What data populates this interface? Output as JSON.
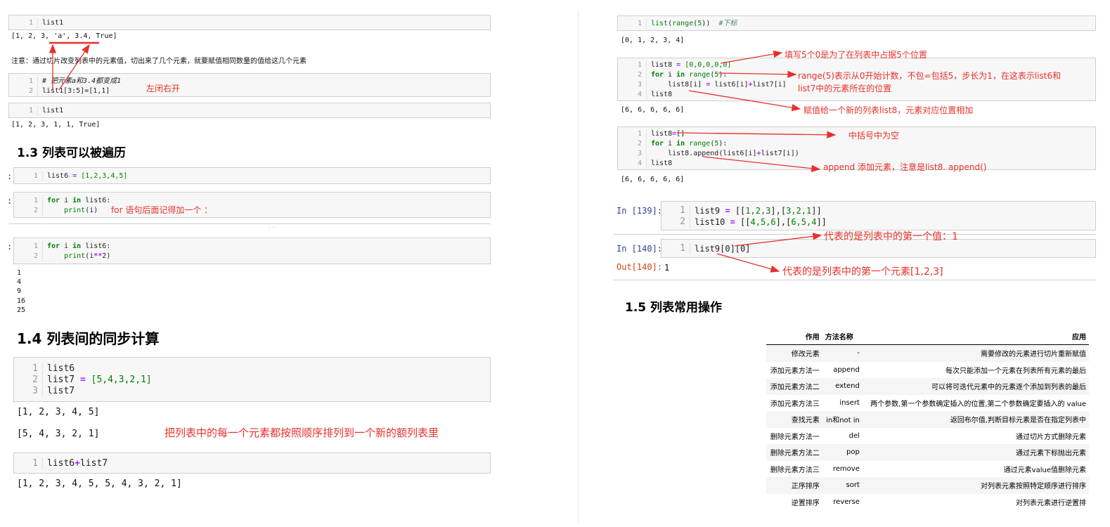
{
  "left": {
    "cell1": {
      "lines": [
        "list1"
      ],
      "line_numbers": [
        "1"
      ]
    },
    "out1": "[1, 2, 3, 'a', 3.4, True]",
    "note_text": "注意：通过切片改变列表中的元素值，切出来了几个元素，就要赋值相同数量的值给这几个元素",
    "cell2": {
      "comment": "# 把元素a和3.4都变成1",
      "code": "list1[3:5]=[1,1]",
      "line_numbers": [
        "1",
        "2"
      ]
    },
    "ann_left_closed": "左闭右开",
    "cell3": {
      "lines": [
        "list1"
      ],
      "line_numbers": [
        "1"
      ]
    },
    "out3": "[1, 2, 3, 1, 1, True]",
    "h_1_3": "1.3  列表可以被遍历",
    "cell4": {
      "code": "list6 = [1,2,3,4,5]",
      "line_numbers": [
        "1"
      ]
    },
    "cell5": {
      "line1": "for i in list6:",
      "line2": "    print(i)",
      "line_numbers": [
        "1",
        "2"
      ]
    },
    "ann_for": "for 语句后面记得加一个  ：",
    "ellipsis": "· · ·",
    "cell6": {
      "line1": "for i in list6:",
      "line2": "    print(i**2)",
      "line_numbers": [
        "1",
        "2"
      ]
    },
    "out6": [
      "1",
      "4",
      "9",
      "16",
      "25"
    ],
    "h_1_4": "1.4  列表间的同步计算",
    "cell7": {
      "line1": "list6",
      "line2": "list7 = [5,4,3,2,1]",
      "line3": "list7",
      "line_numbers": [
        "1",
        "2",
        "3"
      ]
    },
    "out7a": "[1, 2, 3, 4, 5]",
    "out7b": "[5, 4, 3, 2, 1]",
    "ann_sync": "把列表中的每一个元素都按照顺序排列到一个新的额列表里",
    "cell8": {
      "code": "list6+list7",
      "line_numbers": [
        "1"
      ]
    },
    "out8": "[1, 2, 3, 4, 5, 5, 4, 3, 2, 1]",
    "colon_prompts": [
      ":",
      ":",
      ":"
    ]
  },
  "right": {
    "cell1": {
      "code": "list(range(5))",
      "comment": "#下标",
      "line_numbers": [
        "1"
      ]
    },
    "out1": "[0, 1, 2, 3, 4]",
    "cell2": {
      "line1": "list8 = [0,0,0,0,0]",
      "line2": "for i in range(5):",
      "line3": "    list8[i] = list6[i]+list7[i]",
      "line4": "list8",
      "line_numbers": [
        "1",
        "2",
        "3",
        "4"
      ]
    },
    "ann_zeros": "填写5个0是为了在列表中占据5个位置",
    "ann_range_1": "range(5)表示从0开始计数，不包=包括5，步长为1，在这表示list6和",
    "ann_range_2": "list7中的元素所在的位置",
    "ann_assign": "赋值给一个新的列表list8，元素对应位置相加",
    "out2": "[6, 6, 6, 6, 6]",
    "cell3": {
      "line1": "list8=[]",
      "line2": "for i in range(5):",
      "line3": "    list8.append(list6[i]+list7[i])",
      "line4": "list8",
      "line_numbers": [
        "1",
        "2",
        "3",
        "4"
      ]
    },
    "ann_empty": "中括号中为空",
    "ann_append": "append 添加元素，注意是list8. append()",
    "out3": "[6, 6, 6, 6, 6]",
    "prompt_139": "In [139]:",
    "cell4": {
      "line1": "list9 = [[1,2,3],[3,2,1]]",
      "line2": "list10 = [[4,5,6],[6,5,4]]",
      "line_numbers": [
        "1",
        "2"
      ]
    },
    "prompt_140": "In [140]:",
    "cell5": {
      "code": "list9[0][0]",
      "line_numbers": [
        "1"
      ]
    },
    "prompt_out_140": "Out[140]:",
    "out5": "1",
    "ann_first_value": "代表的是列表中的第一个值：1",
    "ann_first_element": "代表的是列表中的第一个元素[1,2,3]",
    "h_1_5": "1.5  列表常用操作",
    "table": {
      "headers": [
        "作用",
        "方法名称",
        "应用"
      ],
      "rows": [
        [
          "修改元素",
          "-",
          "需要修改的元素进行切片重新赋值"
        ],
        [
          "添加元素方法一",
          "append",
          "每次只能添加一个元素在列表所有元素的最后"
        ],
        [
          "添加元素方法二",
          "extend",
          "可以将可迭代元素中的元素逐个添加到列表的最后"
        ],
        [
          "添加元素方法三",
          "insert",
          "两个参数,第一个参数确定插入的位置,第二个参数确定要插入的 value"
        ],
        [
          "查找元素",
          "in和not in",
          "返回布尔值,判断目标元素是否在指定列表中"
        ],
        [
          "删除元素方法一",
          "del",
          "通过切片方式删除元素"
        ],
        [
          "删除元素方法二",
          "pop",
          "通过元素下标抛出元素"
        ],
        [
          "删除元素方法三",
          "remove",
          "通过元素value值删除元素"
        ],
        [
          "正序排序",
          "sort",
          "对列表元素按照特定顺序进行排序"
        ],
        [
          "逆置排序",
          "reverse",
          "对列表元素进行逆置排"
        ]
      ]
    }
  },
  "colors": {
    "annotation": "#e8302a",
    "keyword": "#008000",
    "operator": "#aa22ff",
    "prompt_in": "#303f9f",
    "prompt_out": "#d84315"
  }
}
